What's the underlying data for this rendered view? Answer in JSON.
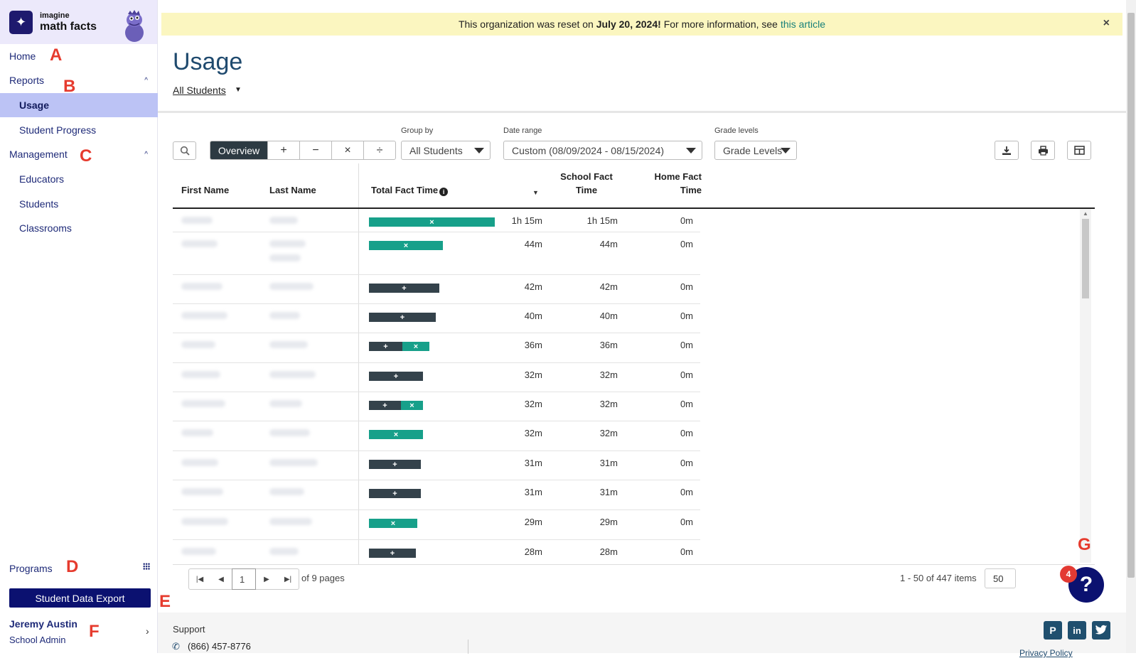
{
  "app": {
    "logo_small": "imagine",
    "logo_big": "math facts"
  },
  "sidebar": {
    "items": [
      {
        "label": "Home"
      },
      {
        "label": "Reports"
      },
      {
        "label": "Usage"
      },
      {
        "label": "Student Progress"
      },
      {
        "label": "Management"
      },
      {
        "label": "Educators"
      },
      {
        "label": "Students"
      },
      {
        "label": "Classrooms"
      }
    ],
    "programs": "Programs",
    "export_button": "Student Data Export",
    "user_name": "Jeremy Austin",
    "user_role": "School Admin"
  },
  "markers": {
    "a": "A",
    "b": "B",
    "c": "C",
    "d": "D",
    "e": "E",
    "f": "F",
    "g": "G"
  },
  "banner": {
    "text_before": "This organization was reset on",
    "date": "July 20, 2024!",
    "text_after": "For more information, see",
    "link": "this article",
    "close": "×"
  },
  "page": {
    "title": "Usage",
    "scope": "All Students"
  },
  "toolbar": {
    "overview": "Overview",
    "ops": [
      "+",
      "−",
      "×",
      "÷"
    ],
    "group_by_label": "Group by",
    "group_by_value": "All Students",
    "date_range_label": "Date range",
    "date_range_value": "Custom (08/09/2024 - 08/15/2024)",
    "grade_label": "Grade levels",
    "grade_value": "Grade Levels"
  },
  "table": {
    "headers": {
      "first_name": "First Name",
      "last_name": "Last Name",
      "total": "Total Fact Time",
      "school_1": "School Fact",
      "school_2": "Time",
      "home_1": "Home Fact",
      "home_2": "Time"
    },
    "rows": [
      {
        "total": "1h 15m",
        "school": "1h 15m",
        "home": "0m",
        "segments": [
          {
            "op": "×",
            "color": "teal",
            "minutes": 75
          }
        ]
      },
      {
        "total": "44m",
        "school": "44m",
        "home": "0m",
        "segments": [
          {
            "op": "×",
            "color": "teal",
            "minutes": 44
          }
        ]
      },
      {
        "total": "42m",
        "school": "42m",
        "home": "0m",
        "segments": [
          {
            "op": "+",
            "color": "dark",
            "minutes": 42
          }
        ]
      },
      {
        "total": "40m",
        "school": "40m",
        "home": "0m",
        "segments": [
          {
            "op": "+",
            "color": "dark",
            "minutes": 40
          }
        ]
      },
      {
        "total": "36m",
        "school": "36m",
        "home": "0m",
        "segments": [
          {
            "op": "+",
            "color": "dark",
            "minutes": 20
          },
          {
            "op": "×",
            "color": "teal",
            "minutes": 16
          }
        ]
      },
      {
        "total": "32m",
        "school": "32m",
        "home": "0m",
        "segments": [
          {
            "op": "+",
            "color": "dark",
            "minutes": 32
          }
        ]
      },
      {
        "total": "32m",
        "school": "32m",
        "home": "0m",
        "segments": [
          {
            "op": "+",
            "color": "dark",
            "minutes": 19
          },
          {
            "op": "×",
            "color": "teal",
            "minutes": 13
          }
        ]
      },
      {
        "total": "32m",
        "school": "32m",
        "home": "0m",
        "segments": [
          {
            "op": "×",
            "color": "teal",
            "minutes": 32
          }
        ]
      },
      {
        "total": "31m",
        "school": "31m",
        "home": "0m",
        "segments": [
          {
            "op": "+",
            "color": "dark",
            "minutes": 31
          }
        ]
      },
      {
        "total": "31m",
        "school": "31m",
        "home": "0m",
        "segments": [
          {
            "op": "+",
            "color": "dark",
            "minutes": 31
          }
        ]
      },
      {
        "total": "29m",
        "school": "29m",
        "home": "0m",
        "segments": [
          {
            "op": "×",
            "color": "teal",
            "minutes": 29
          }
        ]
      },
      {
        "total": "28m",
        "school": "28m",
        "home": "0m",
        "segments": [
          {
            "op": "+",
            "color": "dark",
            "minutes": 28
          }
        ]
      }
    ]
  },
  "pager": {
    "current": "1",
    "pages_text": "of 9 pages",
    "items_text": "1 - 50 of 447 items",
    "per_page": "50"
  },
  "help": {
    "badge": "4",
    "label": "?"
  },
  "footer": {
    "support": "Support",
    "phone": "(866) 457-8776",
    "privacy": "Privacy Policy"
  },
  "colors": {
    "teal": "#17a08a",
    "dark": "#34424b",
    "navy": "#0b1170",
    "banner": "#fbf6c0"
  }
}
